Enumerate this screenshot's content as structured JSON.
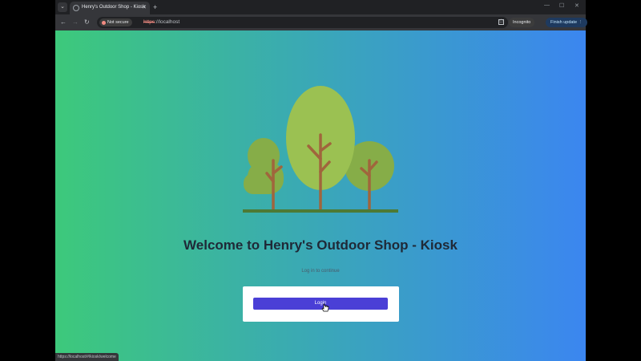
{
  "browser": {
    "tab_menu_icon": "chevron-down-icon",
    "tab": {
      "title": "Henry's Outdoor Shop - Kiosk"
    },
    "new_tab_glyph": "+",
    "toolbar": {
      "security_label": "Not secure",
      "url_scheme": "https",
      "url_rest": "://localhost",
      "incognito_label": "Incognito",
      "finish_update_label": "Finish update"
    },
    "status_url": "https://localhost/#/kiosk/welcome"
  },
  "page": {
    "title": "Welcome to Henry's Outdoor Shop - Kiosk",
    "subtitle": "Log in to continue",
    "login_label": "Login"
  },
  "colors": {
    "gradient_start": "#3dc97b",
    "gradient_end": "#3b86f0",
    "button": "#4a3fd6",
    "tree_light": "#9bc152",
    "tree_dark": "#86ad48",
    "trunk": "#a0653c",
    "ground": "#4d7a35"
  }
}
